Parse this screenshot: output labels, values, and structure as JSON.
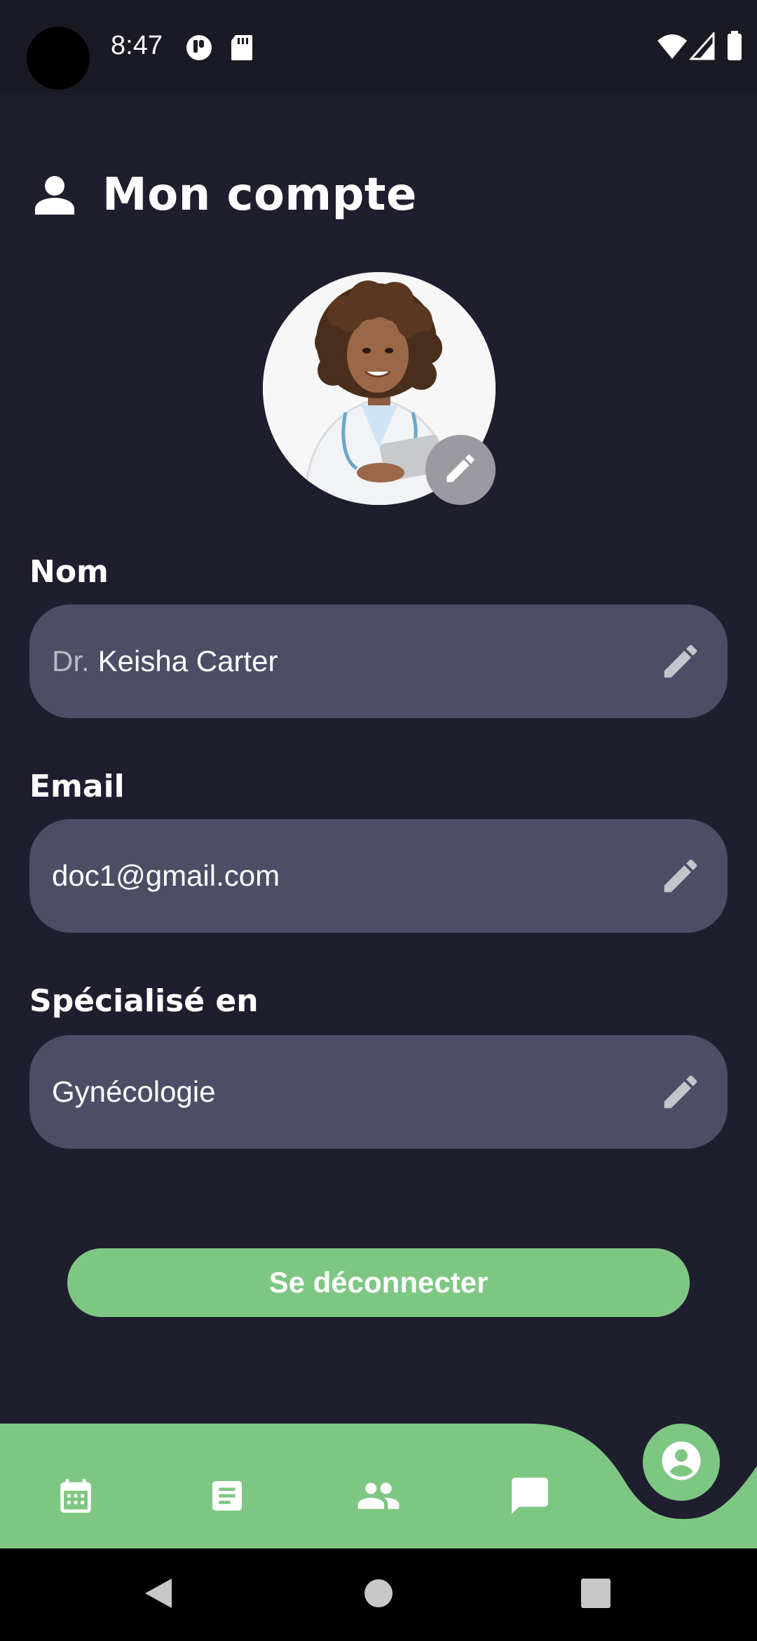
{
  "status_bar": {
    "time": "8:47",
    "icons": [
      "notification-icon",
      "sd-card-icon",
      "wifi-icon",
      "cellular-signal-icon",
      "battery-icon"
    ]
  },
  "header": {
    "title": "Mon compte",
    "icon": "person-icon"
  },
  "profile": {
    "avatar_description": "doctor-portrait",
    "edit_icon": "pencil-icon"
  },
  "fields": {
    "name": {
      "label": "Nom",
      "prefix": "Dr.",
      "value": "Keisha Carter"
    },
    "email": {
      "label": "Email",
      "value": "doc1@gmail.com"
    },
    "specialty": {
      "label": "Spécialisé en",
      "value": "Gynécologie"
    }
  },
  "actions": {
    "logout_label": "Se déconnecter"
  },
  "bottom_nav": {
    "items": [
      "calendar-icon",
      "document-icon",
      "people-icon",
      "chat-icon",
      "account-icon"
    ],
    "active": "account-icon"
  },
  "colors": {
    "background": "#1f1e2e",
    "status_bar": "#1a1a25",
    "field_background": "#4d4e66",
    "accent_green": "#7ec783",
    "edit_badge": "#9b9aa0"
  }
}
